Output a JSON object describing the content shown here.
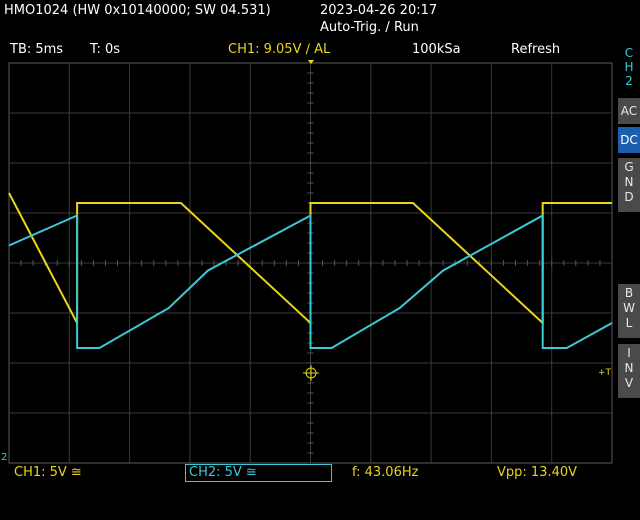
{
  "device": {
    "model_line": "HMO1024 (HW 0x10140000; SW 04.531)",
    "datetime": "2023-04-26 20:17",
    "trigger_status": "Auto-Trig. / Run"
  },
  "info": {
    "timebase": "TB: 5ms",
    "trigger_time": "T: 0s",
    "ch1_trigger": "CH1: 9.05V ∕ AL",
    "sample_rate": "100kSa",
    "mode": "Refresh"
  },
  "side_menu": {
    "channel_label": [
      "C",
      "H",
      "2"
    ],
    "ac": "AC",
    "dc": "DC",
    "gnd": [
      "G",
      "N",
      "D"
    ],
    "bwl": [
      "B",
      "W",
      "L"
    ],
    "inv": [
      "I",
      "N",
      "V"
    ]
  },
  "bottom": {
    "ch1_scale": "CH1: 5V ≅",
    "ch2_scale": "CH2: 5V ≅",
    "frequency": "f: 43.06Hz",
    "vpp": "Vpp: 13.40V"
  },
  "markers": {
    "trigger_right": "+T",
    "ground_left": "2"
  },
  "colors": {
    "ch1": "#e7d51a",
    "ch2": "#3cc9d6",
    "grid": "#3a3a3a",
    "active_button": "#1c5fb0"
  },
  "chart_data": {
    "type": "line",
    "grid": true,
    "divisions": {
      "x": 10,
      "y": 8
    },
    "series": [
      {
        "name": "CH1",
        "x_div": [
          0,
          1.13,
          1.13,
          2.85,
          5.0,
          5.0,
          6.7,
          8.85,
          8.85,
          10
        ],
        "y_div": [
          1.4,
          -1.2,
          1.2,
          1.2,
          -1.2,
          1.2,
          1.2,
          -1.2,
          1.2,
          1.2
        ]
      },
      {
        "name": "CH2",
        "x_div": [
          0,
          1.13,
          1.13,
          1.5,
          2.65,
          3.3,
          5.0,
          5.0,
          5.35,
          6.48,
          7.2,
          8.85,
          8.85,
          9.25,
          10
        ],
        "y_div": [
          0.35,
          0.95,
          -1.7,
          -1.7,
          -0.9,
          -0.15,
          0.95,
          -1.7,
          -1.7,
          -0.9,
          -0.15,
          0.95,
          -1.7,
          -1.7,
          -1.2
        ]
      }
    ]
  }
}
